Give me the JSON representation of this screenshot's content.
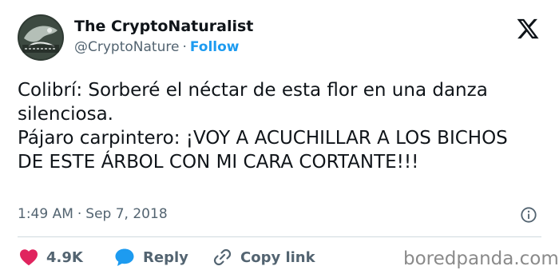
{
  "author": {
    "name": "The CryptoNaturalist",
    "handle": "@CryptoNature",
    "separator": "·",
    "follow_label": "Follow"
  },
  "platform_icon": "x-logo-icon",
  "tweet": {
    "lines": [
      "Colibrí: Sorberé el néctar de esta flor en una danza",
      "silenciosa.",
      "Pájaro carpintero: ¡VOY A ACUCHILLAR A LOS BICHOS",
      "DE ESTE ÁRBOL CON MI CARA CORTANTE!!!"
    ]
  },
  "meta": {
    "time": "1:49 AM",
    "separator": "·",
    "date": "Sep 7, 2018",
    "info_icon": "info-icon"
  },
  "actions": {
    "like_count": "4.9K",
    "reply_label": "Reply",
    "copy_link_label": "Copy link"
  },
  "watermark": "boredpanda.com",
  "colors": {
    "like": "#e0245e",
    "reply": "#1d9bf0",
    "follow": "#1d9bf0",
    "muted": "#536471"
  }
}
